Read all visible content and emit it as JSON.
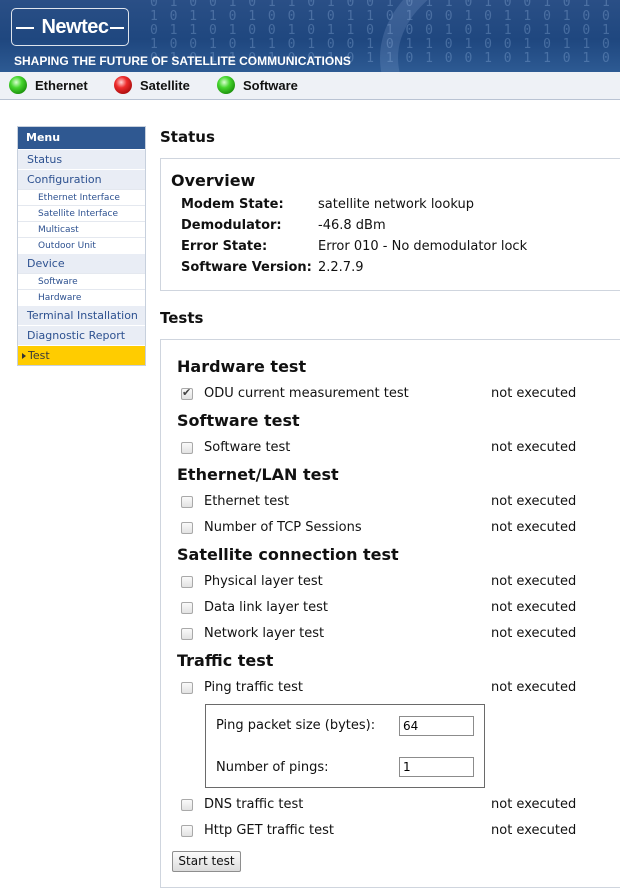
{
  "header": {
    "logo_text": "Newtec",
    "tagline": "SHAPING THE FUTURE OF SATELLITE COMMUNICATIONS",
    "brand_color": "#1f477f"
  },
  "indicators": [
    {
      "label": "Ethernet",
      "state": "green"
    },
    {
      "label": "Satellite",
      "state": "red"
    },
    {
      "label": "Software",
      "state": "green"
    }
  ],
  "menu": {
    "title": "Menu",
    "items": [
      {
        "label": "Status",
        "level": 1
      },
      {
        "label": "Configuration",
        "level": 1
      },
      {
        "label": "Ethernet Interface",
        "level": 2
      },
      {
        "label": "Satellite Interface",
        "level": 2
      },
      {
        "label": "Multicast",
        "level": 2
      },
      {
        "label": "Outdoor Unit",
        "level": 2
      },
      {
        "label": "Device",
        "level": 1
      },
      {
        "label": "Software",
        "level": 2
      },
      {
        "label": "Hardware",
        "level": 2
      },
      {
        "label": "Terminal Installation",
        "level": 1
      },
      {
        "label": "Diagnostic Report",
        "level": 1
      },
      {
        "label": "Test",
        "level": 1,
        "active": true
      }
    ],
    "active_color": "#ffcc00"
  },
  "status": {
    "heading": "Status",
    "overview": {
      "title": "Overview",
      "rows": [
        {
          "key": "Modem State:",
          "value": "satellite network lookup"
        },
        {
          "key": "Demodulator:",
          "value": "-46.8 dBm"
        },
        {
          "key": "Error State:",
          "value": "Error 010 - No demodulator lock"
        },
        {
          "key": "Software Version:",
          "value": "2.2.7.9"
        }
      ]
    }
  },
  "tests": {
    "heading": "Tests",
    "groups": [
      {
        "title": "Hardware test",
        "items": [
          {
            "label": "ODU current measurement test",
            "status": "not executed",
            "checked": true
          }
        ]
      },
      {
        "title": "Software test",
        "items": [
          {
            "label": "Software test",
            "status": "not executed",
            "checked": false
          }
        ]
      },
      {
        "title": "Ethernet/LAN test",
        "items": [
          {
            "label": "Ethernet test",
            "status": "not executed",
            "checked": false
          },
          {
            "label": "Number of TCP Sessions",
            "status": "not executed",
            "checked": false
          }
        ]
      },
      {
        "title": "Satellite connection test",
        "items": [
          {
            "label": "Physical layer test",
            "status": "not executed",
            "checked": false
          },
          {
            "label": "Data link layer test",
            "status": "not executed",
            "checked": false
          },
          {
            "label": "Network layer test",
            "status": "not executed",
            "checked": false
          }
        ]
      },
      {
        "title": "Traffic test",
        "items": [
          {
            "label": "Ping traffic test",
            "status": "not executed",
            "checked": false
          },
          {
            "label": "DNS traffic test",
            "status": "not executed",
            "checked": false
          },
          {
            "label": "Http GET traffic test",
            "status": "not executed",
            "checked": false
          }
        ]
      }
    ],
    "ping_options": {
      "packet_size_label": "Ping packet size (bytes):",
      "packet_size_value": "64",
      "count_label": "Number of pings:",
      "count_value": "1"
    },
    "start_button": "Start test"
  }
}
